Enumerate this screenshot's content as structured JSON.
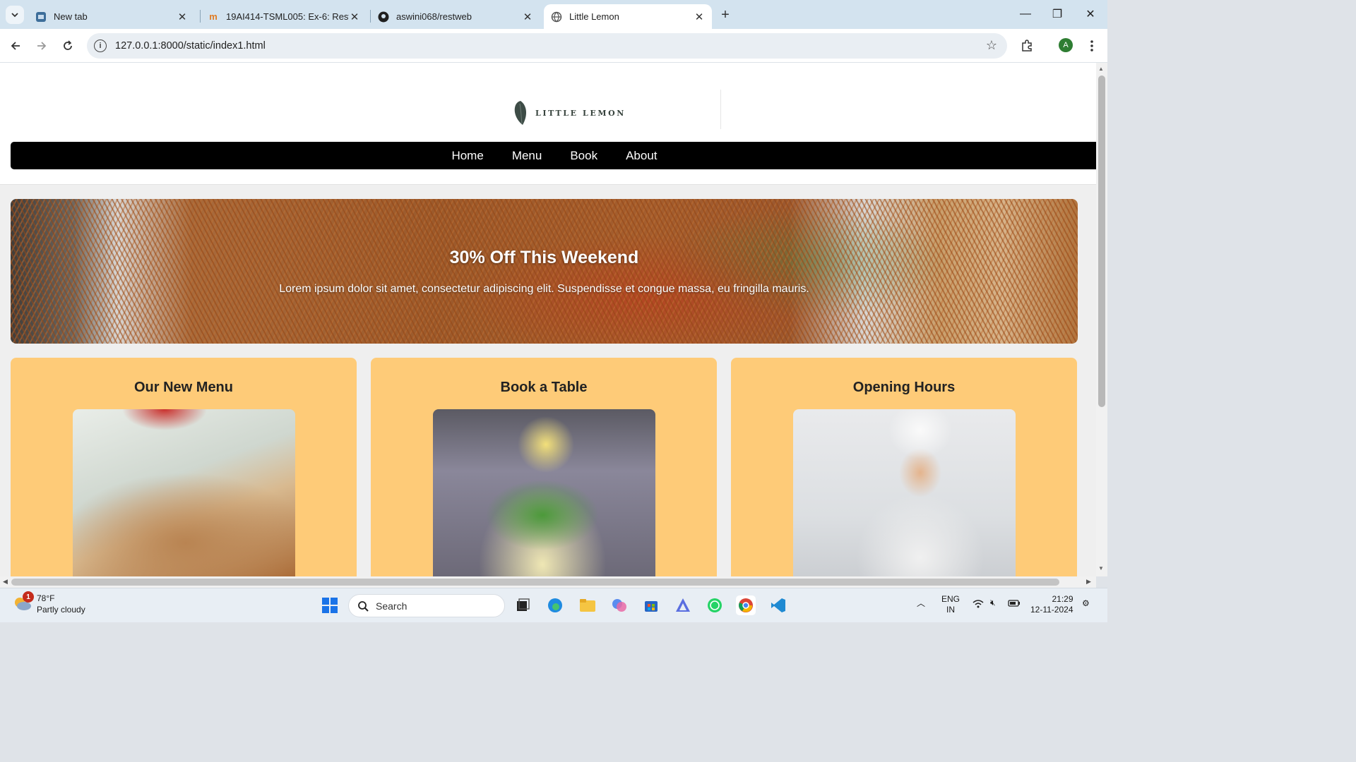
{
  "browser": {
    "tabs": [
      {
        "title": "New tab",
        "active": false
      },
      {
        "title": "19AI414-TSML005: Ex-6: Restau",
        "active": false
      },
      {
        "title": "aswini068/restweb",
        "active": false
      },
      {
        "title": "Little Lemon",
        "active": true
      }
    ],
    "url": "127.0.0.1:8000/static/index1.html",
    "profile_initial": "A"
  },
  "site": {
    "brand": "LITTLE LEMON",
    "nav": [
      "Home",
      "Menu",
      "Book",
      "About"
    ],
    "hero": {
      "title": "30% Off This Weekend",
      "text": "Lorem ipsum dolor sit amet, consectetur adipiscing elit. Suspendisse et congue massa, eu fringilla mauris."
    },
    "cards": [
      {
        "title": "Our New Menu",
        "image": "wrap-photo"
      },
      {
        "title": "Book a Table",
        "image": "drink-photo"
      },
      {
        "title": "Opening Hours",
        "image": "chef-photo"
      }
    ]
  },
  "taskbar": {
    "weather_temp": "78°F",
    "weather_desc": "Partly cloudy",
    "weather_badge": "1",
    "search_placeholder": "Search",
    "lang_top": "ENG",
    "lang_bottom": "IN",
    "time": "21:29",
    "date": "12-11-2024"
  },
  "colors": {
    "card_bg": "#fecb78",
    "nav_bg": "#000000",
    "tabstrip_bg": "#d3e3ef"
  }
}
